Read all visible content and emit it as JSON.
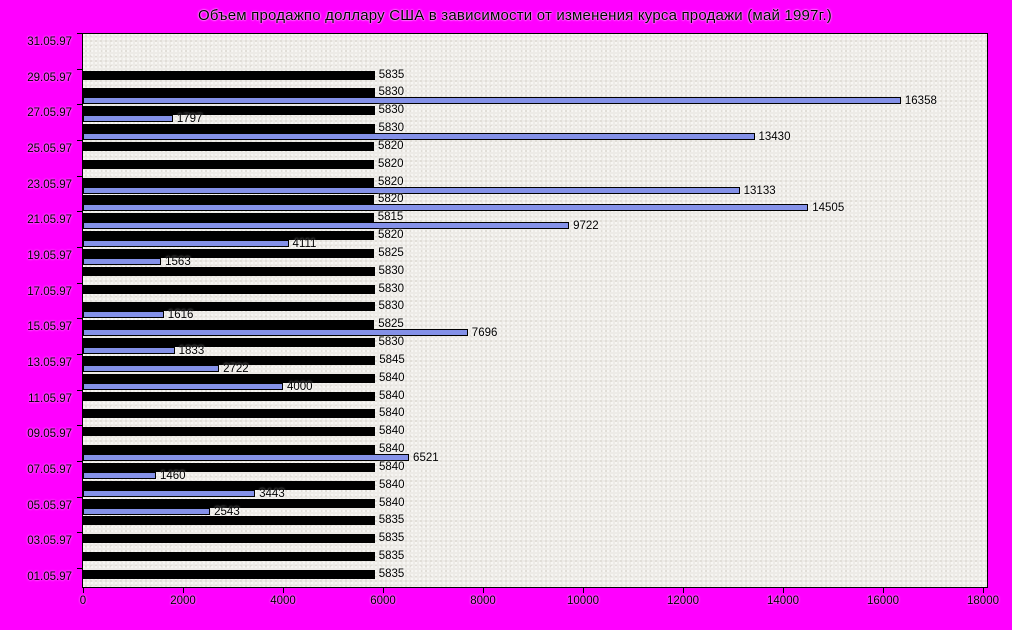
{
  "title": "Объем продажпо доллару США в зависимости от изменения курса продажи (май 1997г.)",
  "colors": {
    "page_background": "#FF00FF",
    "plot_background": "#EDEBE7",
    "rate_bar": "#000000",
    "volume_bar": "#8491E8",
    "volume_bar_border": "#000000",
    "text": "#000000"
  },
  "chart_data": {
    "type": "bar",
    "orientation": "horizontal",
    "title": "Объем продажпо доллару США в зависимости от изменения курса продажи (май 1997г.)",
    "xlim": [
      0,
      18000
    ],
    "x_tick_values": [
      0,
      2000,
      4000,
      6000,
      8000,
      10000,
      12000,
      14000,
      16000,
      18000
    ],
    "x_tick_labels": [
      "0",
      "2000",
      "4000",
      "6000",
      "8000",
      "10000",
      "12000",
      "14000",
      "16000",
      "18000"
    ],
    "grid": false,
    "legend": null,
    "series_note": "each category row has a black bar (exchange rate, labeled) and a blue bar (sales volume, labeled when present)",
    "rows_top_to_bottom": [
      {
        "label": "31.05.97",
        "rate": null,
        "volume": null
      },
      {
        "label": "",
        "rate": null,
        "volume": null
      },
      {
        "label": "29.05.97",
        "rate": 5835,
        "volume": null
      },
      {
        "label": "",
        "rate": 5830,
        "volume": 16358
      },
      {
        "label": "27.05.97",
        "rate": 5830,
        "volume": 1797
      },
      {
        "label": "",
        "rate": 5830,
        "volume": 13430
      },
      {
        "label": "25.05.97",
        "rate": 5820,
        "volume": null
      },
      {
        "label": "",
        "rate": 5820,
        "volume": null
      },
      {
        "label": "23.05.97",
        "rate": 5820,
        "volume": 13133
      },
      {
        "label": "",
        "rate": 5820,
        "volume": 14505
      },
      {
        "label": "21.05.97",
        "rate": 5815,
        "volume": 9722
      },
      {
        "label": "",
        "rate": 5820,
        "volume": 4111
      },
      {
        "label": "19.05.97",
        "rate": 5825,
        "volume": 1563
      },
      {
        "label": "",
        "rate": 5830,
        "volume": null
      },
      {
        "label": "17.05.97",
        "rate": 5830,
        "volume": null
      },
      {
        "label": "",
        "rate": 5830,
        "volume": 1616
      },
      {
        "label": "15.05.97",
        "rate": 5825,
        "volume": 7696
      },
      {
        "label": "",
        "rate": 5830,
        "volume": 1833
      },
      {
        "label": "13.05.97",
        "rate": 5845,
        "volume": 2722
      },
      {
        "label": "",
        "rate": 5840,
        "volume": 4000
      },
      {
        "label": "11.05.97",
        "rate": 5840,
        "volume": null
      },
      {
        "label": "",
        "rate": 5840,
        "volume": null
      },
      {
        "label": "09.05.97",
        "rate": 5840,
        "volume": null
      },
      {
        "label": "",
        "rate": 5840,
        "volume": 6521
      },
      {
        "label": "07.05.97",
        "rate": 5840,
        "volume": 1460
      },
      {
        "label": "",
        "rate": 5840,
        "volume": 3443
      },
      {
        "label": "05.05.97",
        "rate": 5840,
        "volume": 2543
      },
      {
        "label": "",
        "rate": 5835,
        "volume": null
      },
      {
        "label": "03.05.97",
        "rate": 5835,
        "volume": null
      },
      {
        "label": "",
        "rate": 5835,
        "volume": null
      },
      {
        "label": "01.05.97",
        "rate": 5835,
        "volume": null
      }
    ]
  }
}
